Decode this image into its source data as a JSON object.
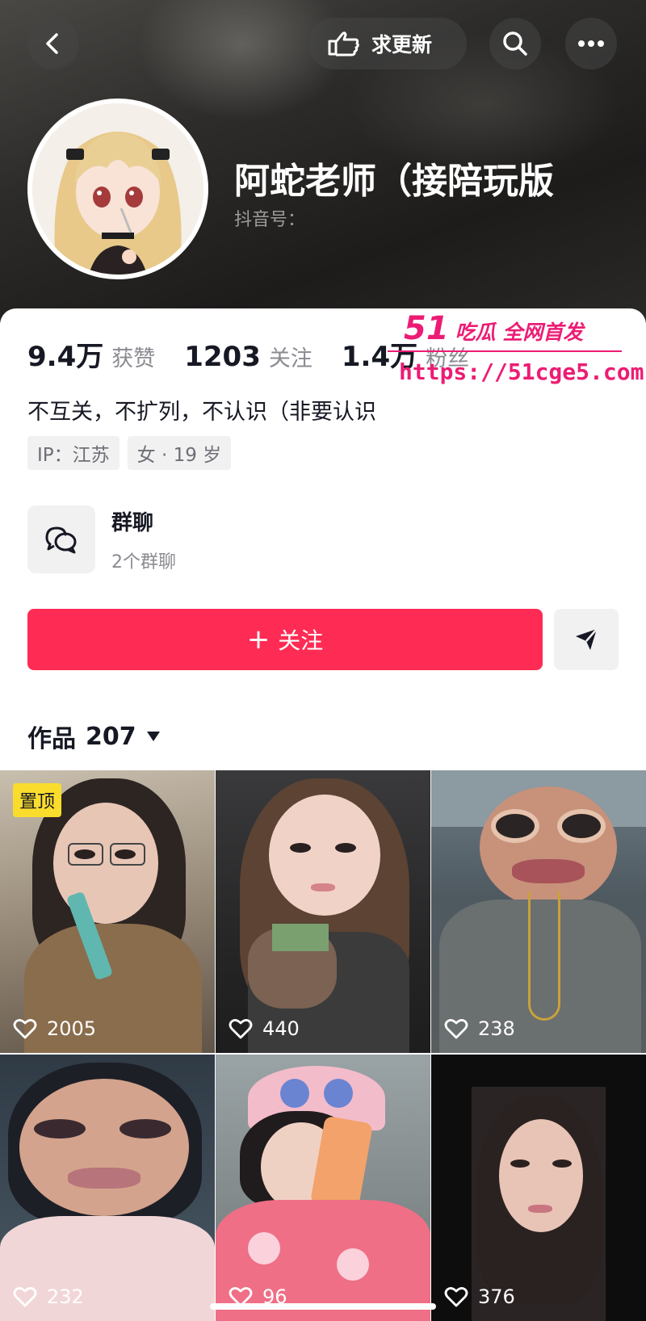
{
  "header": {
    "request_update_label": "求更新",
    "nickname": "阿蛇老师（接陪玩版",
    "douyin_id_label": "抖音号："
  },
  "stats": [
    {
      "value": "9.4万",
      "label": "获赞"
    },
    {
      "value": "1203",
      "label": "关注"
    },
    {
      "value": "1.4万",
      "label": "粉丝"
    }
  ],
  "bio": "不互关，不扩列，不认识（非要认识",
  "tags": [
    "IP：江苏",
    "女 · 19 岁"
  ],
  "group_chat": {
    "title": "群聊",
    "subtitle": "2个群聊"
  },
  "follow_button": {
    "plus": "+",
    "label": "关注"
  },
  "works": {
    "label": "作品",
    "count": "207"
  },
  "pinned_label": "置顶",
  "videos": [
    {
      "likes": "2005",
      "pinned": true
    },
    {
      "likes": "440"
    },
    {
      "likes": "238"
    },
    {
      "likes": "232"
    },
    {
      "likes": "96"
    },
    {
      "likes": "376"
    }
  ],
  "watermark": {
    "brand_num": "51",
    "brand_text": "吃瓜 全网首发",
    "url": "https://51cge5.com"
  },
  "colors": {
    "accent": "#fe2c55",
    "watermark": "#ec1c74",
    "pin": "#fadc2d"
  },
  "icons": [
    "back-arrow-icon",
    "hand-pointer-icon",
    "search-icon",
    "more-icon",
    "group-chat-icon",
    "share-arrow-icon",
    "triangle-down-icon",
    "heart-icon"
  ]
}
